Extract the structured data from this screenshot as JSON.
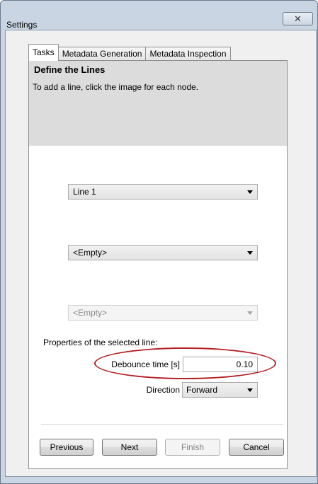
{
  "window": {
    "title": "Settings",
    "close_glyph": "✕"
  },
  "tabs": [
    {
      "label": "Tasks",
      "active": true
    },
    {
      "label": "Metadata Generation",
      "active": false
    },
    {
      "label": "Metadata Inspection",
      "active": false
    }
  ],
  "header": {
    "title": "Define the Lines",
    "description": "To add a line, click the image for each node."
  },
  "lines": {
    "combo1": {
      "value": "Line 1",
      "enabled": true
    },
    "combo2": {
      "value": "<Empty>",
      "enabled": true
    },
    "combo3": {
      "value": "<Empty>",
      "enabled": false
    }
  },
  "properties": {
    "label": "Properties of the selected line:",
    "debounce_label": "Debounce time [s]",
    "debounce_value": "0.10",
    "direction_label": "Direction",
    "direction_value": "Forward"
  },
  "buttons": {
    "previous": "Previous",
    "next": "Next",
    "finish": "Finish",
    "cancel": "Cancel"
  },
  "colors": {
    "highlight_ellipse": "#b41f24",
    "header_background": "#dcdcdc",
    "window_frame": "#c9d5e3"
  },
  "icons": {
    "close": "close-icon",
    "dropdown": "chevron-down-icon"
  }
}
